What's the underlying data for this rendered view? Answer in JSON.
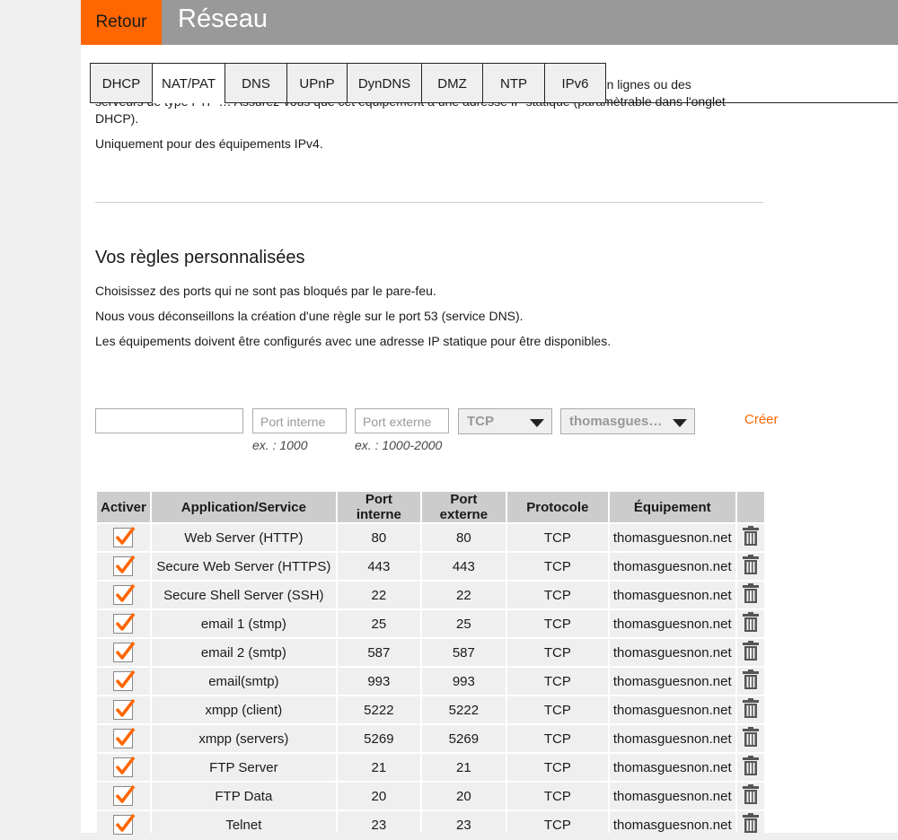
{
  "header": {
    "back_label": "Retour",
    "title": "Réseau",
    "accent_color": "#ff6600",
    "bar_color": "#999999"
  },
  "tabs": [
    {
      "label": "DHCP",
      "active": false
    },
    {
      "label": "NAT/PAT",
      "active": true
    },
    {
      "label": "DNS",
      "active": false
    },
    {
      "label": "UPnP",
      "active": false
    },
    {
      "label": "DynDNS",
      "active": false
    },
    {
      "label": "DMZ",
      "active": false
    },
    {
      "label": "NTP",
      "active": false
    },
    {
      "label": "IPv6",
      "active": false
    }
  ],
  "intro": {
    "line_hidden": "équipement particulier de votre réseau. Utiles pour certaines applications comme des jeux en lignes ou des",
    "paragraph_rest": "serveurs de type FTP … Assurez-vous que cet équipement a une adresse IP statique (paramètrable dans l'onglet DHCP).",
    "note": "Uniquement pour des équipements IPv4."
  },
  "rules_section": {
    "title": "Vos règles personnalisées",
    "help": [
      "Choisissez des ports qui ne sont pas bloqués par le pare-feu.",
      "Nous vous déconseillons la création d'une règle sur le port 53 (service DNS).",
      "Les équipements doivent être configurés avec une adresse IP statique pour être disponibles."
    ]
  },
  "form": {
    "name_value": "",
    "port_internal_placeholder": "Port interne",
    "port_external_placeholder": "Port externe",
    "port_internal_hint": "ex. : 1000",
    "port_external_hint": "ex. : 1000-2000",
    "protocol_selected": "TCP",
    "device_selected": "thomasgues…",
    "create_label": "Créer"
  },
  "table": {
    "headers": [
      "Activer",
      "Application/Service",
      "Port interne",
      "Port externe",
      "Protocole",
      "Équipement",
      ""
    ],
    "rows": [
      {
        "active": true,
        "service": "Web Server (HTTP)",
        "port_int": "80",
        "port_ext": "80",
        "protocol": "TCP",
        "device": "thomasguesnon.net"
      },
      {
        "active": true,
        "service": "Secure Web Server (HTTPS)",
        "port_int": "443",
        "port_ext": "443",
        "protocol": "TCP",
        "device": "thomasguesnon.net"
      },
      {
        "active": true,
        "service": "Secure Shell Server (SSH)",
        "port_int": "22",
        "port_ext": "22",
        "protocol": "TCP",
        "device": "thomasguesnon.net"
      },
      {
        "active": true,
        "service": "email 1 (stmp)",
        "port_int": "25",
        "port_ext": "25",
        "protocol": "TCP",
        "device": "thomasguesnon.net"
      },
      {
        "active": true,
        "service": "email 2 (smtp)",
        "port_int": "587",
        "port_ext": "587",
        "protocol": "TCP",
        "device": "thomasguesnon.net"
      },
      {
        "active": true,
        "service": "email(smtp)",
        "port_int": "993",
        "port_ext": "993",
        "protocol": "TCP",
        "device": "thomasguesnon.net"
      },
      {
        "active": true,
        "service": "xmpp (client)",
        "port_int": "5222",
        "port_ext": "5222",
        "protocol": "TCP",
        "device": "thomasguesnon.net"
      },
      {
        "active": true,
        "service": "xmpp (servers)",
        "port_int": "5269",
        "port_ext": "5269",
        "protocol": "TCP",
        "device": "thomasguesnon.net"
      },
      {
        "active": true,
        "service": "FTP Server",
        "port_int": "21",
        "port_ext": "21",
        "protocol": "TCP",
        "device": "thomasguesnon.net"
      },
      {
        "active": true,
        "service": "FTP Data",
        "port_int": "20",
        "port_ext": "20",
        "protocol": "TCP",
        "device": "thomasguesnon.net"
      },
      {
        "active": true,
        "service": "Telnet",
        "port_int": "23",
        "port_ext": "23",
        "protocol": "TCP",
        "device": "thomasguesnon.net"
      }
    ]
  }
}
